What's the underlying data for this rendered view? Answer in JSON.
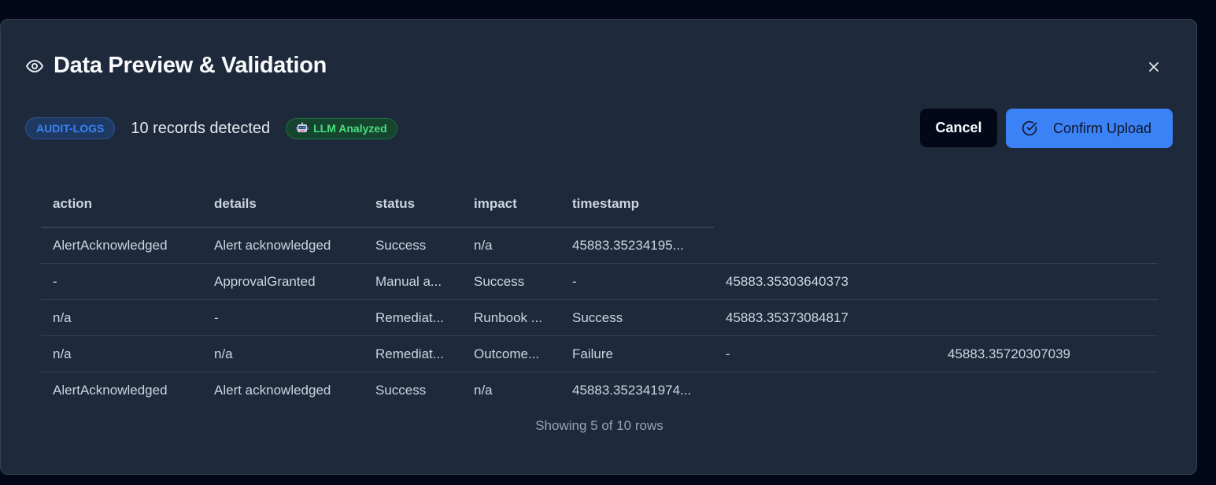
{
  "dialog": {
    "title": "Data Preview & Validation",
    "close_icon": "close-icon",
    "view_icon": "eye-icon"
  },
  "meta": {
    "type_badge": "AUDIT-LOGS",
    "records_text": "10 records detected",
    "llm_badge": "LLM Analyzed",
    "llm_icon": "robot-icon"
  },
  "actions": {
    "cancel_label": "Cancel",
    "confirm_label": "Confirm Upload",
    "confirm_icon": "check-circle-icon"
  },
  "table": {
    "columns": [
      "action",
      "details",
      "status",
      "impact",
      "timestamp"
    ],
    "rows": [
      [
        "AlertAcknowledged",
        "Alert acknowledged",
        "Success",
        "n/a",
        "45883.35234195..."
      ],
      [
        "-",
        "ApprovalGranted",
        "Manual a...",
        "Success",
        "-",
        "45883.35303640373"
      ],
      [
        "n/a",
        "-",
        "Remediat...",
        "Runbook ...",
        "Success",
        "45883.35373084817"
      ],
      [
        "n/a",
        "n/a",
        "Remediat...",
        "Outcome...",
        "Failure",
        "-",
        "45883.35720307039"
      ],
      [
        "AlertAcknowledged",
        "Alert acknowledged",
        "Success",
        "n/a",
        "45883.352341974..."
      ]
    ]
  },
  "footer": {
    "showing_text": "Showing 5 of 10 rows"
  },
  "colors": {
    "background": "#020817",
    "modal": "#1e293b",
    "accent": "#3b82f6",
    "success": "#4ade80"
  }
}
